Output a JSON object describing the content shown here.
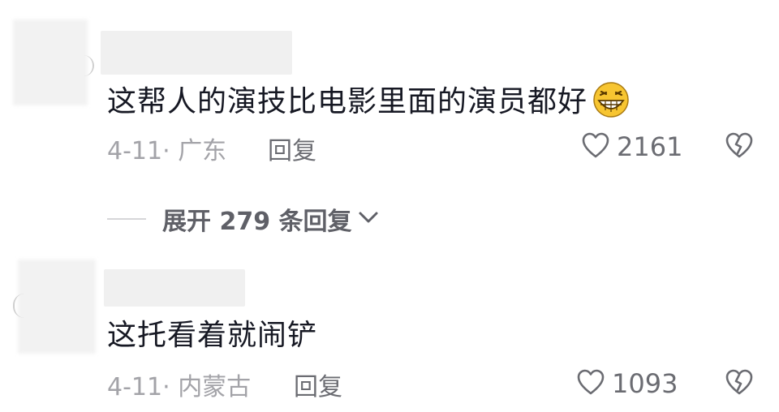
{
  "comments": [
    {
      "text": "这帮人的演技比电影里面的演员都好",
      "emoji": "grinning-face-emoji",
      "date": "4-11",
      "separator": "·",
      "location": "广东",
      "reply_label": "回复",
      "likes": "2161"
    },
    {
      "text": "这托看着就闹铲",
      "date": "4-11",
      "separator": "·",
      "location": "内蒙古",
      "reply_label": "回复",
      "likes": "1093"
    }
  ],
  "expand_replies": {
    "label": "展开 279 条回复",
    "icon": "chevron-down-icon"
  },
  "colors": {
    "text": "#161823",
    "meta": "#a3a3a8",
    "action": "#6b6c72",
    "emoji_face": "#f7c531"
  }
}
